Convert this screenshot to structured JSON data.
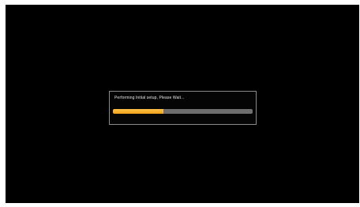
{
  "setup_dialog": {
    "message": "Performing Initial setup, Please Wait...",
    "progress_fraction": 0.36,
    "progress_color": "#f5ad2d",
    "track_color": "#6e6e6e",
    "border_color": "#8a8a8a",
    "background_color": "#000000"
  }
}
